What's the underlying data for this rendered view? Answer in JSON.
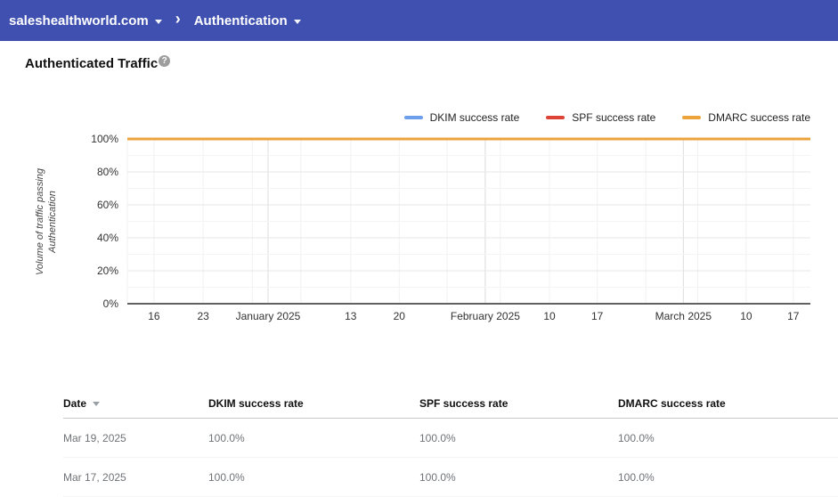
{
  "header": {
    "domain": "saleshealthworld.com",
    "section": "Authentication",
    "breadcrumb_separator": "›",
    "bar_color": "#3f50b0"
  },
  "page": {
    "title": "Authenticated Traffic",
    "help_icon_glyph": "?"
  },
  "chart_data": {
    "type": "line",
    "title": "Authenticated Traffic",
    "ylabel": "Volume of traffic passing Authentication",
    "ylabel_lines": [
      "Volume of traffic passing",
      "Authentication"
    ],
    "ylim": [
      0,
      100
    ],
    "grid": true,
    "legend_position": "top-right",
    "y_major_ticks": [
      {
        "value": 0,
        "label": "0%"
      },
      {
        "value": 20,
        "label": "20%"
      },
      {
        "value": 40,
        "label": "40%"
      },
      {
        "value": 60,
        "label": "60%"
      },
      {
        "value": 80,
        "label": "80%"
      },
      {
        "value": 100,
        "label": "100%"
      }
    ],
    "y_minor_tick_values": [
      10,
      30,
      50,
      70,
      90
    ],
    "x_ticks": [
      {
        "label": "16",
        "pos": 3.9,
        "month_boundary": false
      },
      {
        "label": "23",
        "pos": 11.1,
        "month_boundary": false
      },
      {
        "label": "January 2025",
        "pos": 20.6,
        "month_boundary": true
      },
      {
        "label": "13",
        "pos": 32.7,
        "month_boundary": false
      },
      {
        "label": "20",
        "pos": 39.8,
        "month_boundary": false
      },
      {
        "label": "February 2025",
        "pos": 52.4,
        "month_boundary": true
      },
      {
        "label": "10",
        "pos": 61.8,
        "month_boundary": false
      },
      {
        "label": "17",
        "pos": 68.8,
        "month_boundary": false
      },
      {
        "label": "March 2025",
        "pos": 81.4,
        "month_boundary": true
      },
      {
        "label": "10",
        "pos": 90.6,
        "month_boundary": false
      },
      {
        "label": "17",
        "pos": 97.5,
        "month_boundary": false
      }
    ],
    "x_unlabeled_gridline_pos": [
      0,
      18.3,
      25.4,
      46.8,
      54.6,
      75.9,
      83.5
    ],
    "series": [
      {
        "name": "DKIM success rate",
        "color": "#6d9eeb",
        "constant_value_percent": 100
      },
      {
        "name": "SPF success rate",
        "color": "#dc4437",
        "constant_value_percent": 100
      },
      {
        "name": "DMARC success rate",
        "color": "#eda33b",
        "constant_value_percent": 100
      }
    ]
  },
  "table": {
    "columns": [
      {
        "label": "Date",
        "sortable": true,
        "sort_direction": "desc"
      },
      {
        "label": "DKIM success rate",
        "sortable": false
      },
      {
        "label": "SPF success rate",
        "sortable": false
      },
      {
        "label": "DMARC success rate",
        "sortable": false
      }
    ],
    "rows": [
      [
        "Mar 19, 2025",
        "100.0%",
        "100.0%",
        "100.0%"
      ],
      [
        "Mar 17, 2025",
        "100.0%",
        "100.0%",
        "100.0%"
      ]
    ]
  }
}
